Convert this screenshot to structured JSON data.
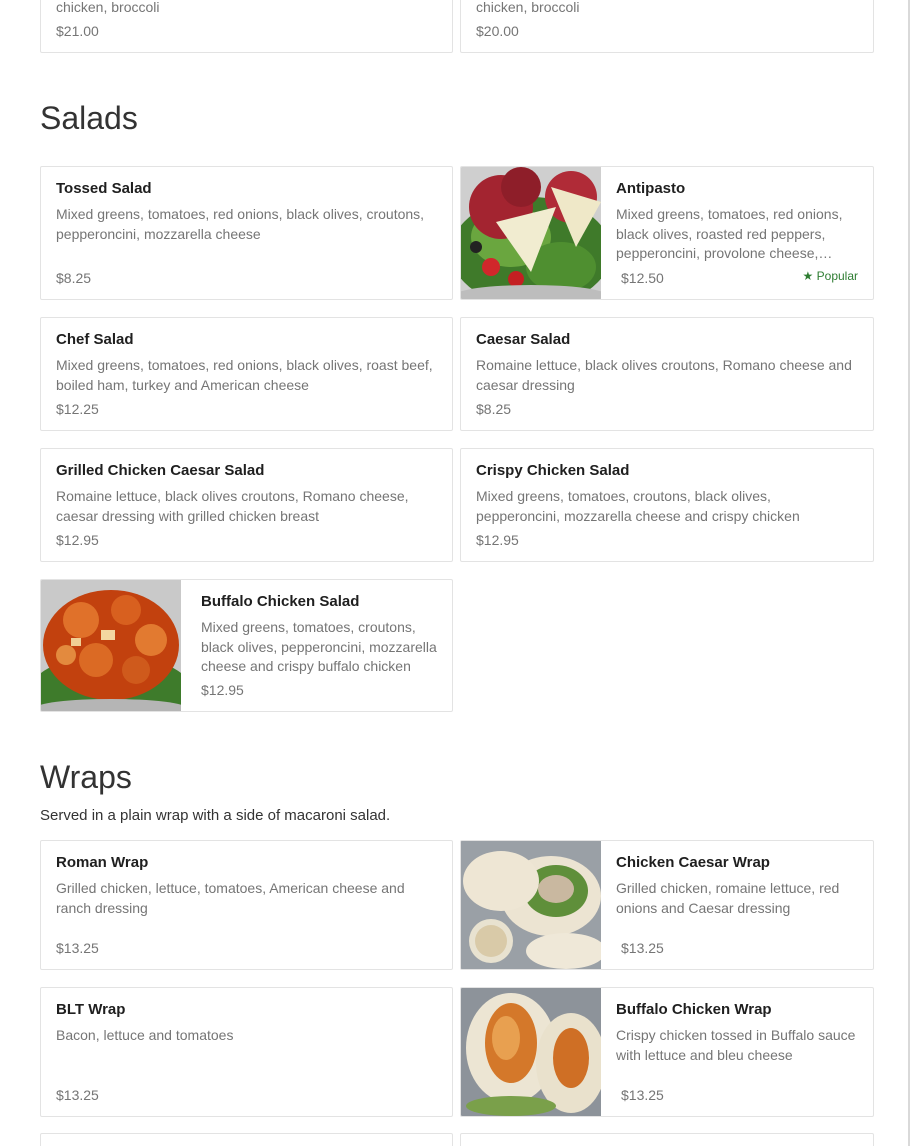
{
  "top_cards": [
    {
      "desc_tail": "chicken, broccoli",
      "price": "$21.00"
    },
    {
      "desc_tail": "chicken, broccoli",
      "price": "$20.00"
    }
  ],
  "salads": {
    "title": "Salads",
    "items": [
      {
        "name": "Tossed Salad",
        "desc": "Mixed greens, tomatoes, red onions, black olives, croutons, pepperoncini, mozzarella cheese",
        "price": "$8.25"
      },
      {
        "name": "Antipasto",
        "desc": "Mixed greens, tomatoes, red onions, black olives, roasted red peppers, pepperoncini, provolone cheese, salami and ham",
        "price": "$12.50",
        "badge": "★ Popular"
      },
      {
        "name": "Chef Salad",
        "desc": "Mixed greens, tomatoes, red onions, black olives, roast beef, boiled ham, turkey and American cheese",
        "price": "$12.25"
      },
      {
        "name": "Caesar Salad",
        "desc": "Romaine lettuce, black olives croutons, Romano cheese and caesar dressing",
        "price": "$8.25"
      },
      {
        "name": "Grilled Chicken Caesar Salad",
        "desc": "Romaine lettuce, black olives croutons, Romano cheese, caesar dressing with grilled chicken breast",
        "price": "$12.95"
      },
      {
        "name": "Crispy Chicken Salad",
        "desc": "Mixed greens, tomatoes, croutons, black olives, pepperoncini, mozzarella cheese and crispy chicken",
        "price": "$12.95"
      },
      {
        "name": "Buffalo Chicken Salad",
        "desc": "Mixed greens, tomatoes, croutons, black olives, pepperoncini, mozzarella cheese and crispy buffalo chicken",
        "price": "$12.95"
      }
    ]
  },
  "wraps": {
    "title": "Wraps",
    "subtitle": "Served in a plain wrap with a side of macaroni salad.",
    "items": [
      {
        "name": "Roman Wrap",
        "desc": "Grilled chicken, lettuce, tomatoes, American cheese and ranch dressing",
        "price": "$13.25"
      },
      {
        "name": "Chicken Caesar Wrap",
        "desc": "Grilled chicken, romaine lettuce, red onions and Caesar dressing",
        "price": "$13.25"
      },
      {
        "name": "BLT Wrap",
        "desc": "Bacon, lettuce and tomatoes",
        "price": "$13.25"
      },
      {
        "name": "Buffalo Chicken Wrap",
        "desc": "Crispy chicken tossed in Buffalo sauce with lettuce and bleu cheese",
        "price": "$13.25"
      }
    ]
  },
  "colors": {
    "border": "#e3e3e3",
    "muted": "#757575",
    "popular": "#2e7d32"
  }
}
